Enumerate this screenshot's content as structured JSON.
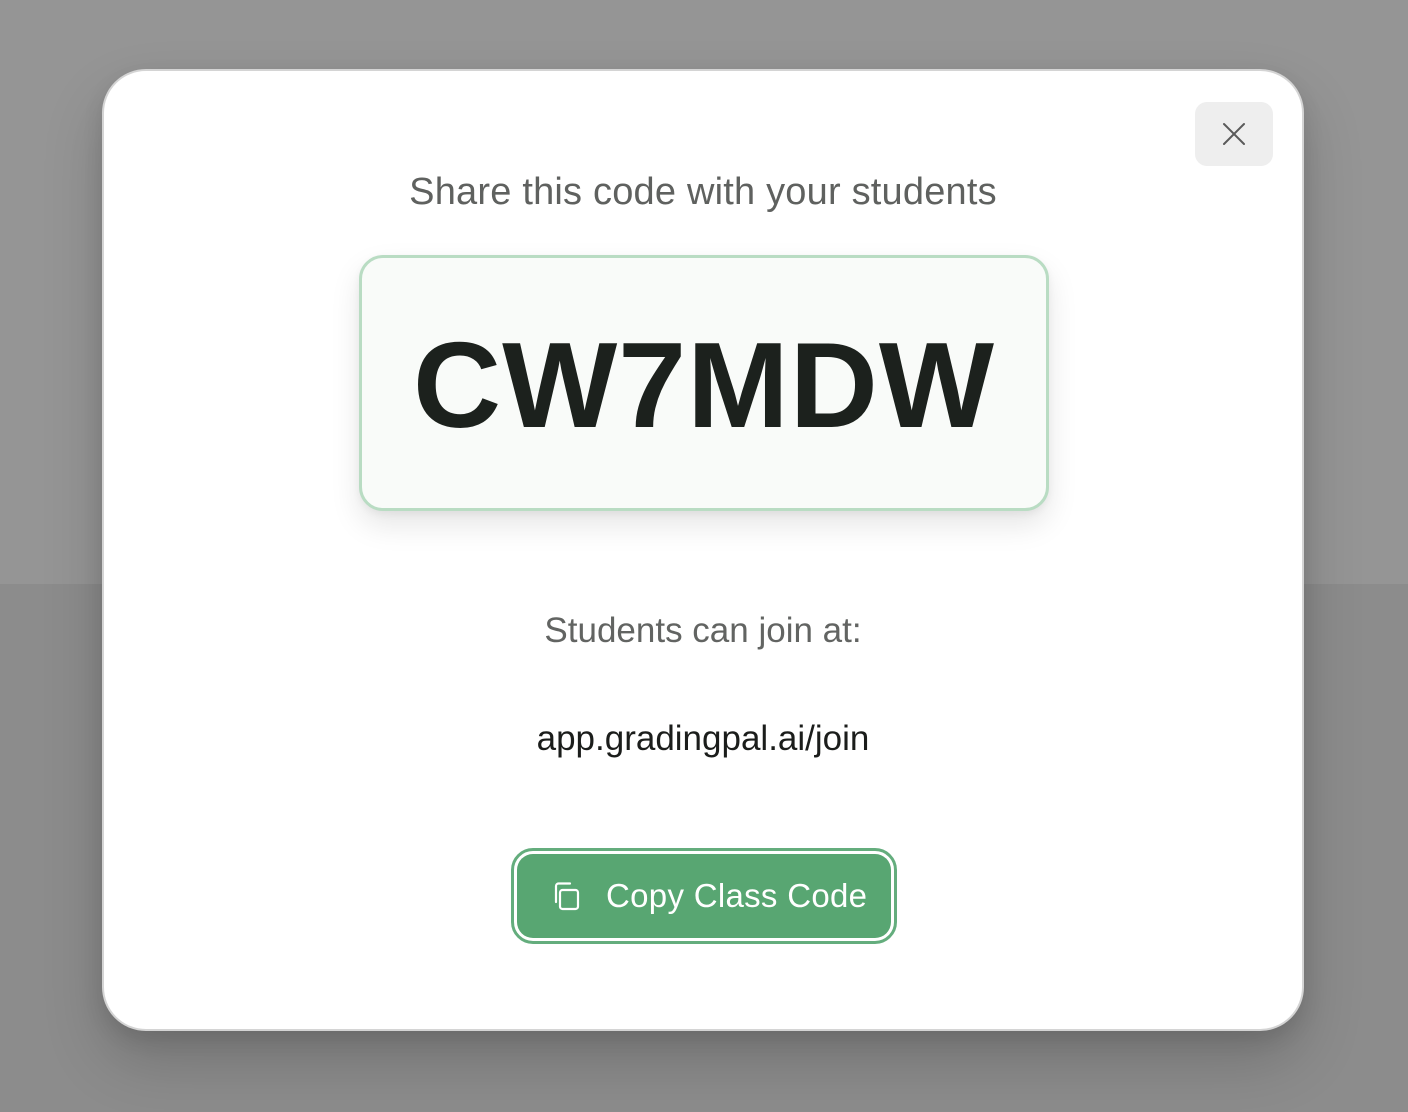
{
  "modal": {
    "title": "Share this code with your students",
    "class_code": "CW7MDW",
    "join_label": "Students can join at:",
    "join_url": "app.gradingpal.ai/join",
    "copy_button_label": "Copy Class Code",
    "close_icon": "close-icon",
    "copy_icon": "copy-icon"
  },
  "colors": {
    "accent": "#58a672",
    "code_border": "#b9dcc3",
    "code_background": "#f9fbf9",
    "close_background": "#eeeeee"
  }
}
